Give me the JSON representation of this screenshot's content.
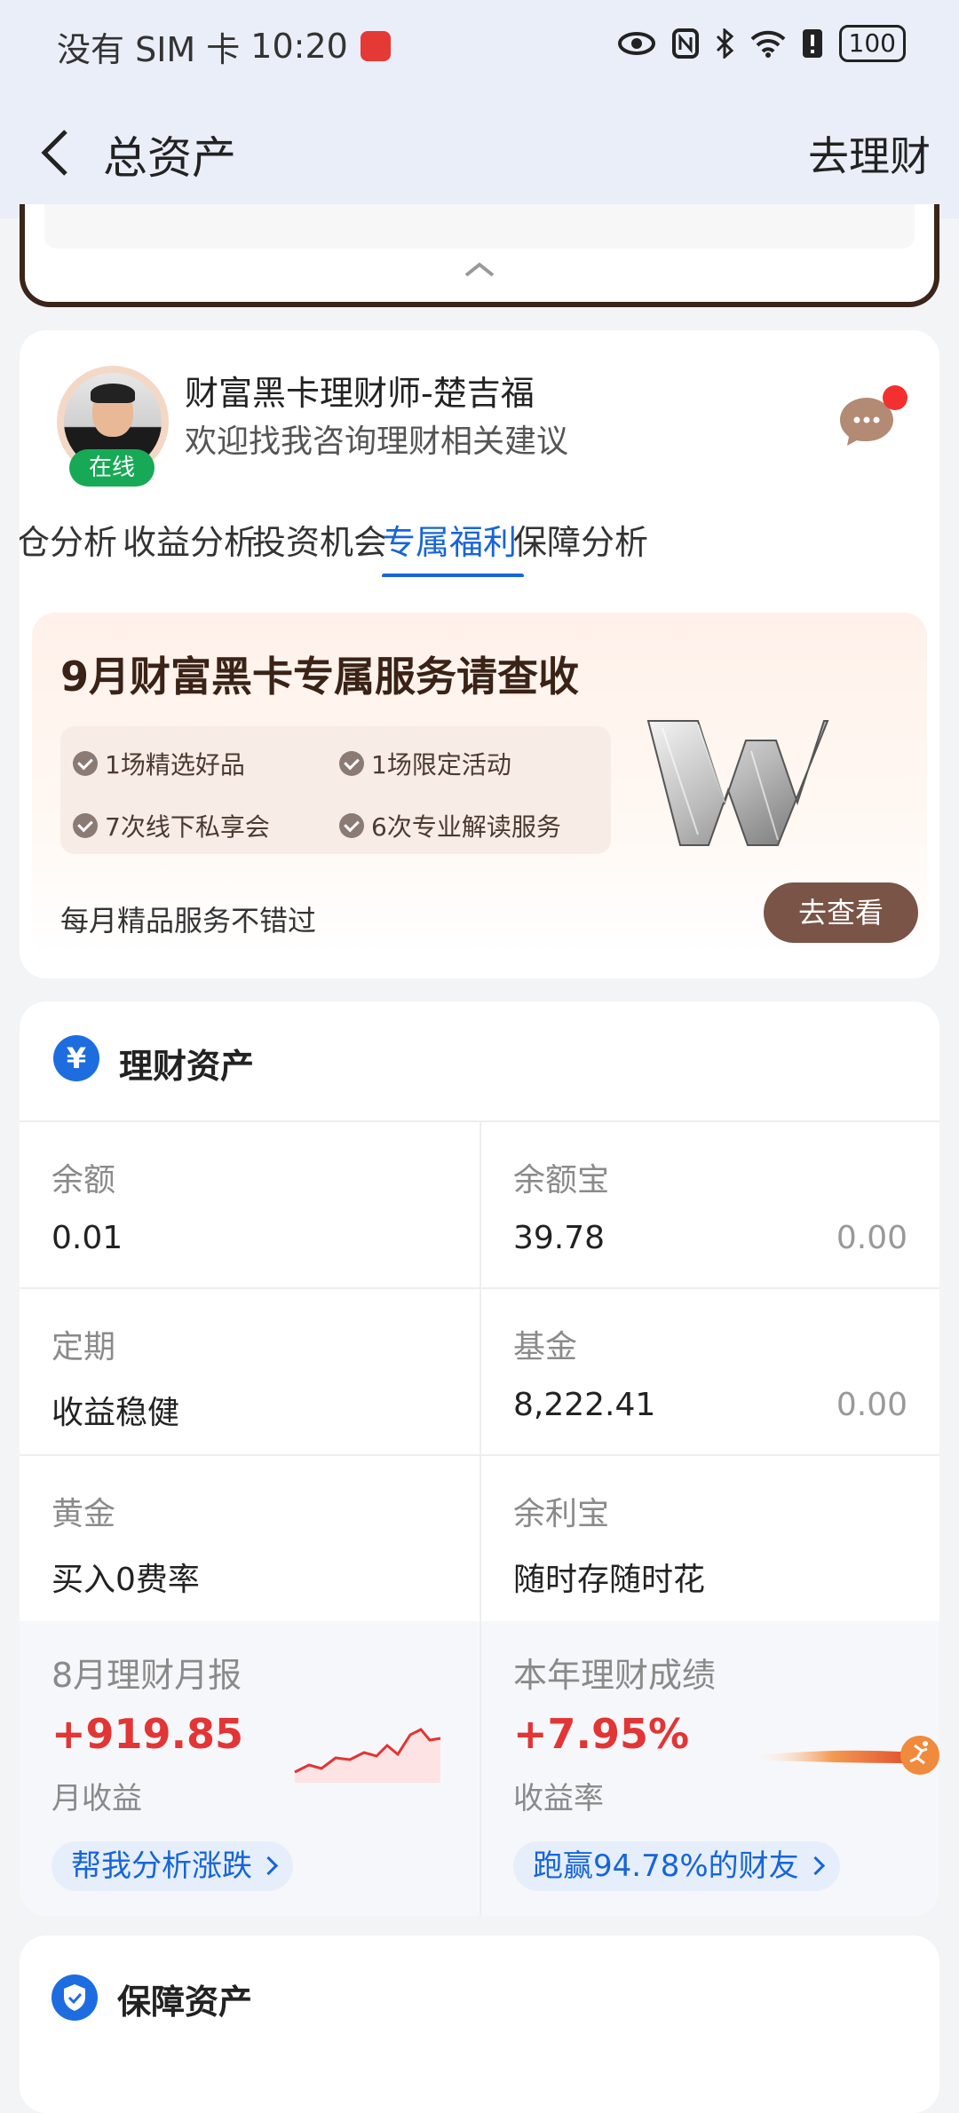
{
  "status_bar": {
    "carrier": "没有 SIM 卡",
    "time": "10:20",
    "battery": "100"
  },
  "nav": {
    "title": "总资产",
    "action": "去理财"
  },
  "advisor": {
    "name": "财富黑卡理财师-楚吉福",
    "subtitle": "欢迎找我咨询理财相关建议",
    "status": "在线"
  },
  "tabs": [
    {
      "label": "仓分析"
    },
    {
      "label": "收益分析"
    },
    {
      "label": "投资机会"
    },
    {
      "label": "专属福利",
      "active": true
    },
    {
      "label": "保障分析"
    }
  ],
  "promo": {
    "title": "9月财富黑卡专属服务请查收",
    "benefits": [
      "1场精选好品",
      "1场限定活动",
      "7次线下私享会",
      "6次专业解读服务"
    ],
    "footer": "每月精品服务不错过",
    "button": "去查看"
  },
  "wealth_assets": {
    "title": "理财资产",
    "icon": "¥",
    "items": [
      {
        "label": "余额",
        "value": "0.01",
        "value2": ""
      },
      {
        "label": "余额宝",
        "value": "39.78",
        "value2": "0.00"
      },
      {
        "label": "定期",
        "value": "收益稳健",
        "value2": ""
      },
      {
        "label": "基金",
        "value": "8,222.41",
        "value2": "0.00"
      },
      {
        "label": "黄金",
        "value": "买入0费率",
        "value2": ""
      },
      {
        "label": "余利宝",
        "value": "随时存随时花",
        "value2": ""
      }
    ],
    "monthly_report": {
      "label": "8月理财月报",
      "value": "+919.85",
      "sub": "月收益",
      "link": "帮我分析涨跌"
    },
    "annual": {
      "label": "本年理财成绩",
      "value": "+7.95%",
      "sub": "收益率",
      "link": "跑赢94.78%的财友"
    }
  },
  "insurance_assets": {
    "title": "保障资产"
  },
  "colors": {
    "accent": "#1765d8",
    "gain": "#e23535",
    "brown": "#7a5446",
    "online": "#17a955"
  }
}
